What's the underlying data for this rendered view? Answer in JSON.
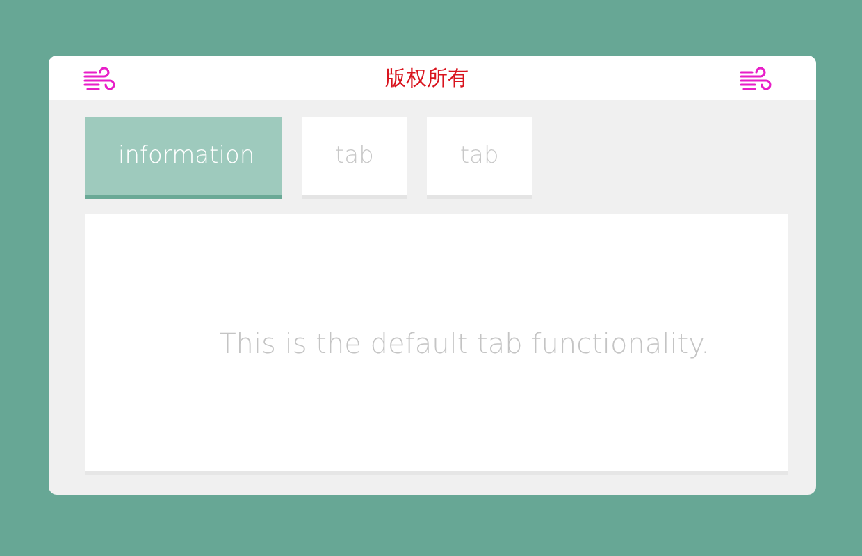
{
  "header": {
    "title": "版权所有"
  },
  "tabs": [
    {
      "label": "information",
      "selected": true
    },
    {
      "label": "tab",
      "selected": false
    },
    {
      "label": "tab",
      "selected": false
    }
  ],
  "panel": {
    "text": "This is the default tab functionality."
  }
}
